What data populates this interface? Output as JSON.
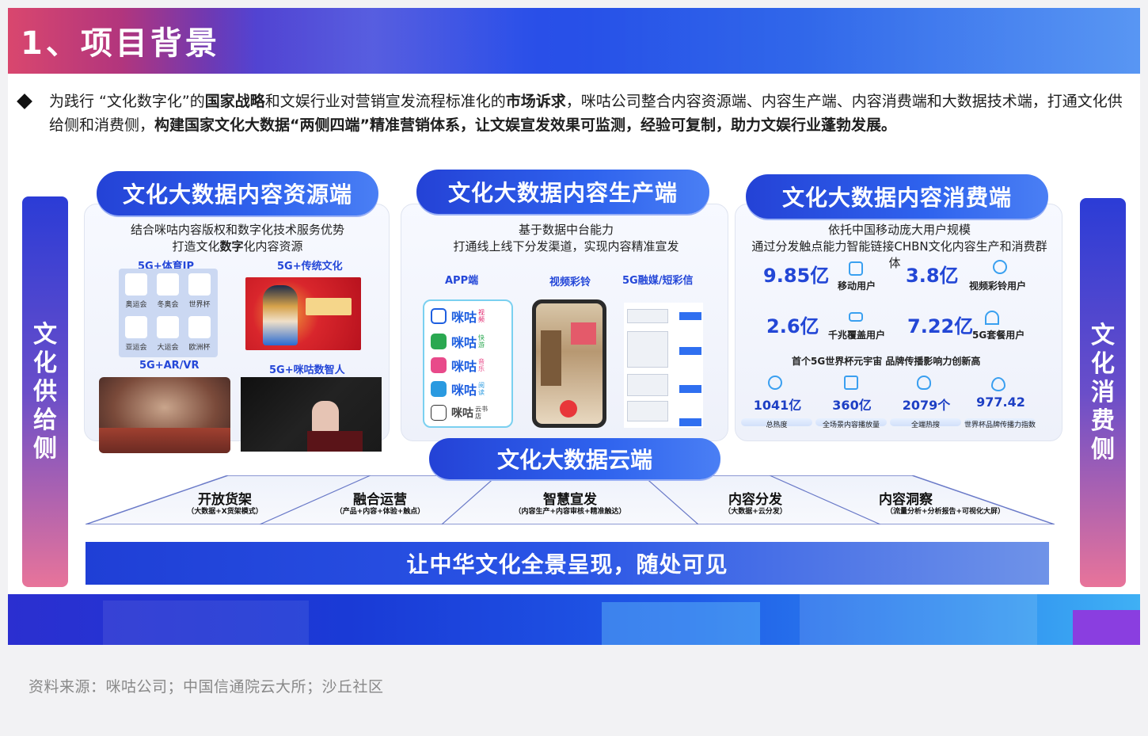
{
  "header": {
    "title": "1、项目背景"
  },
  "intro": {
    "parts": [
      {
        "text": "为践行  “文化数字化”的",
        "bold": false
      },
      {
        "text": "国家战略",
        "bold": true
      },
      {
        "text": "和文娱行业对营销宣发流程标准化的",
        "bold": false
      },
      {
        "text": "市场诉求",
        "bold": true
      },
      {
        "text": "，咪咕公司整合内容资源端、内容生产端、内容消费端和大数据技术端，打通文化供给侧和消费侧，",
        "bold": false
      },
      {
        "text": "构建国家文化大数据“两侧四端”精准营销体系，让文娱宣发效果可监测，经验可复制，助力文娱行业蓬勃发展。",
        "bold": true
      }
    ]
  },
  "pillars": {
    "left": [
      "文",
      "化",
      "供",
      "给",
      "侧"
    ],
    "right": [
      "文",
      "化",
      "消",
      "费",
      "侧"
    ]
  },
  "panel_a": {
    "title": "文化大数据内容资源端",
    "sub1": "结合咪咕内容版权和数字化技术服务优势",
    "sub2_pre": "打造文化",
    "sub2_bold": "数字",
    "sub2_post": "化内容资源",
    "tags": [
      "5G+体育IP",
      "5G+传统文化",
      "5G+AR/VR",
      "5G+咪咕数智人"
    ],
    "olympic_labels": [
      "奥运会",
      "冬奥会",
      "世界杯",
      "亚运会",
      "大运会",
      "欧洲杯"
    ]
  },
  "panel_b": {
    "title": "文化大数据内容生产端",
    "sub1": "基于数据中台能力",
    "sub2": "打通线上线下分发渠道，实现内容精准宣发",
    "tags": [
      "APP端",
      "视频彩铃",
      "5G融媒/短彩信"
    ],
    "apps": [
      {
        "name": "咪咕",
        "suffix": "视频",
        "color": "#e0206a"
      },
      {
        "name": "咪咕",
        "suffix": "快游",
        "color": "#2aa850"
      },
      {
        "name": "咪咕",
        "suffix": "音乐",
        "color": "#e84a8a"
      },
      {
        "name": "咪咕",
        "suffix": "阅读",
        "color": "#2a9ae0"
      },
      {
        "name": "咪咕",
        "suffix": "云书店",
        "color": "#333333"
      }
    ]
  },
  "panel_c": {
    "title": "文化大数据内容消费端",
    "sub1": "依托中国移动庞大用户规模",
    "sub2": "通过分发触点能力智能链接CHBN文化内容生产和消费群",
    "sub2_tail": "体",
    "stats": [
      {
        "num": "9.85亿",
        "label": "移动用户",
        "icon": "phone-icon"
      },
      {
        "num": "3.8亿",
        "label": "视频彩铃用户",
        "icon": "music-icon"
      },
      {
        "num": "2.6亿",
        "label": "千兆覆盖用户",
        "icon": "router-icon"
      },
      {
        "num": "7.22亿",
        "label": "5G套餐用户",
        "icon": "signal-icon"
      }
    ],
    "headline": "首个5G世界杯元宇宙 品牌传播影响力创新高",
    "minis": [
      {
        "num": "1041亿",
        "label": "总热度",
        "icon": "play-icon"
      },
      {
        "num": "360亿",
        "label": "全场景内容播放量",
        "icon": "doc-icon"
      },
      {
        "num": "2079个",
        "label": "全端热搜",
        "icon": "flame-icon"
      },
      {
        "num": "977.42",
        "label": "世界杯品牌传播力指数",
        "icon": "eye-icon"
      }
    ]
  },
  "cloud": {
    "title": "文化大数据云端",
    "segments": [
      {
        "title": "开放货架",
        "sub": "（大数据+X货架模式）"
      },
      {
        "title": "融合运营",
        "sub": "（产品+内容+体验+触点）"
      },
      {
        "title": "智慧宣发",
        "sub": "（内容生产+内容审核+精准触达）"
      },
      {
        "title": "内容分发",
        "sub": "（大数据+云分发）"
      },
      {
        "title": "内容洞察",
        "sub": "（流量分析+分析报告+可视化大屏）"
      }
    ]
  },
  "slogan": "让中华文化全景呈现，随处可见",
  "source": "资料来源：咪咕公司；中国信通院云大所；沙丘社区",
  "colors": {
    "accent": "#2447d8",
    "title_blue": "#2f63ee",
    "number_blue": "#2347d6"
  }
}
